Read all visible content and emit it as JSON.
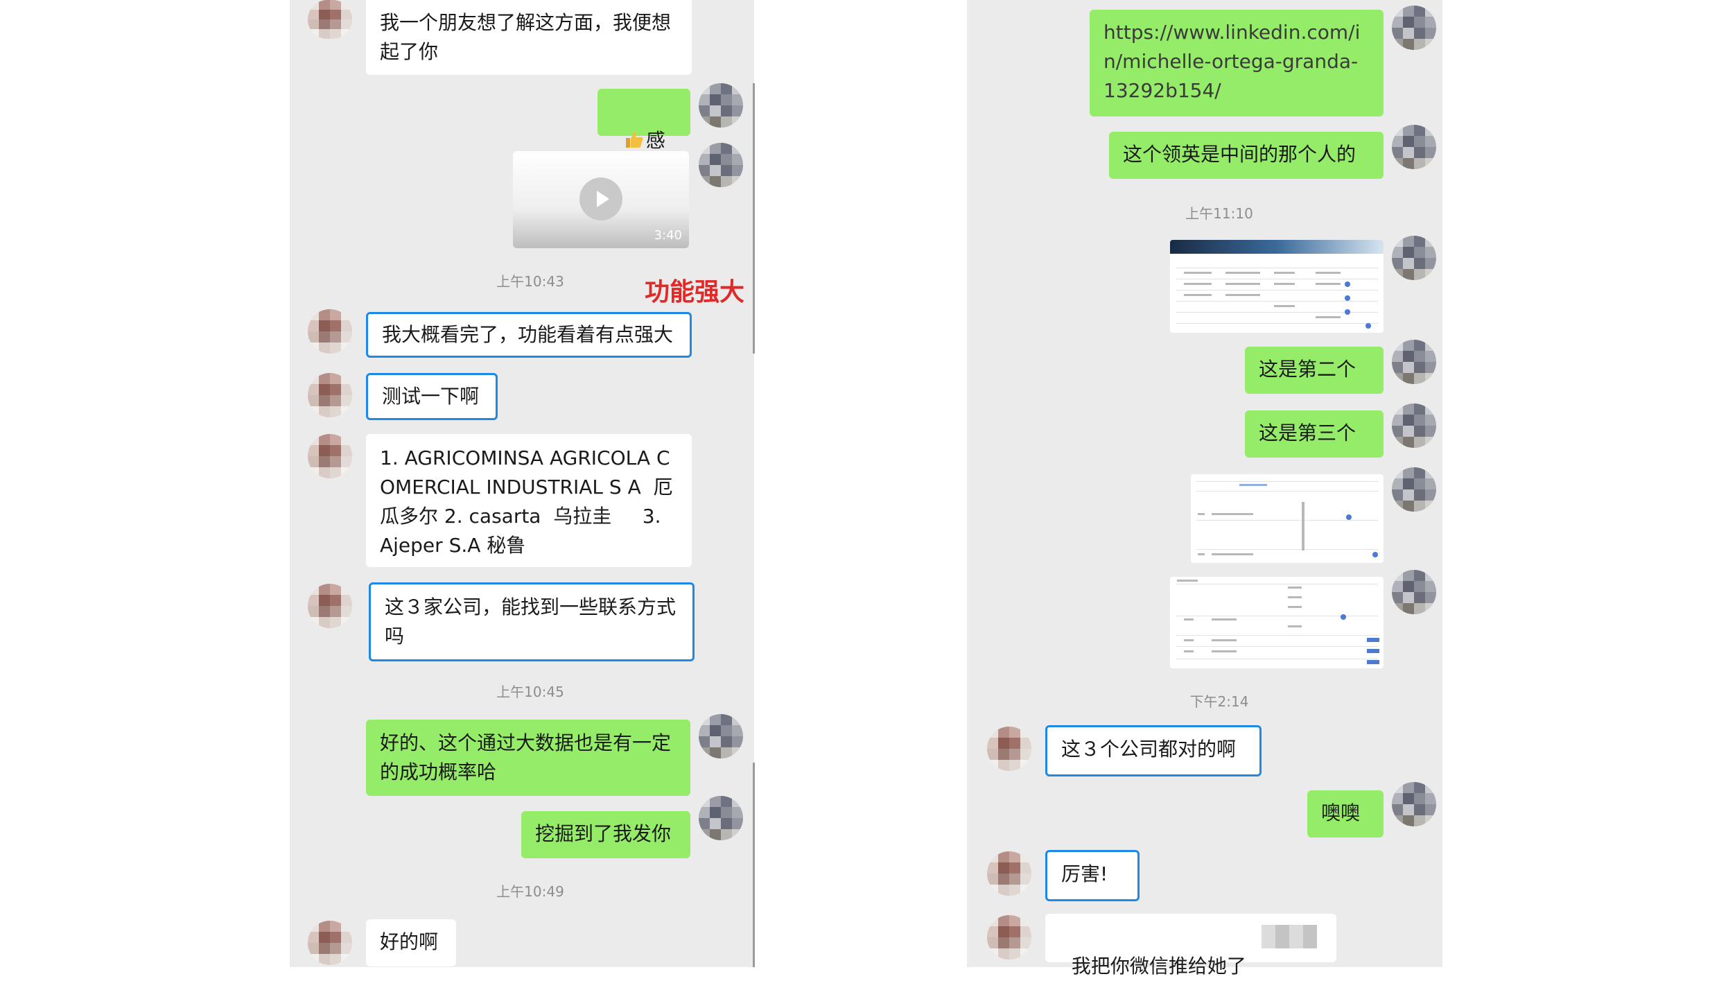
{
  "left": {
    "annotation": "功能强大",
    "messages": [
      {
        "text": "我一个朋友想了解这方面，我便想起了你"
      },
      {
        "text": "感谢",
        "icon": "thumbs-up-icon"
      },
      {
        "duration": "3:40"
      },
      {
        "text": "我大概看完了，功能看着有点强大"
      },
      {
        "text": "测试一下啊"
      },
      {
        "text": "1. AGRICOMINSA AGRICOLA COMERCIAL INDUSTRIAL S A  厄瓜多尔 2. casarta  乌拉圭     3. Ajeper S.A 秘鲁"
      },
      {
        "text": "这３家公司，能找到一些联系方式吗"
      },
      {
        "text": "好的、这个通过大数据也是有一定的成功概率哈"
      },
      {
        "text": "挖掘到了我发你"
      },
      {
        "text": "好的啊"
      }
    ],
    "timestamps": [
      "上午10:43",
      "上午10:45",
      "上午10:49"
    ]
  },
  "right": {
    "messages": [
      {
        "text": "https://www.linkedin.com/in/michelle-ortega-granda-13292b154/"
      },
      {
        "text": "这个领英是中间的那个人的"
      },
      {
        "text": "这是第二个"
      },
      {
        "text": "这是第三个"
      },
      {
        "text": "这３个公司都对的啊"
      },
      {
        "text": "噢噢"
      },
      {
        "text": "厉害!"
      },
      {
        "text": "我把你微信推给她了"
      }
    ],
    "timestamps": [
      "上午11:10",
      "下午2:14"
    ]
  },
  "colors": {
    "self_bubble": "#95ec69",
    "other_bubble": "#ffffff",
    "highlight": "#1e88e5",
    "annotation": "#e02a2a",
    "background": "#ebebeb"
  }
}
